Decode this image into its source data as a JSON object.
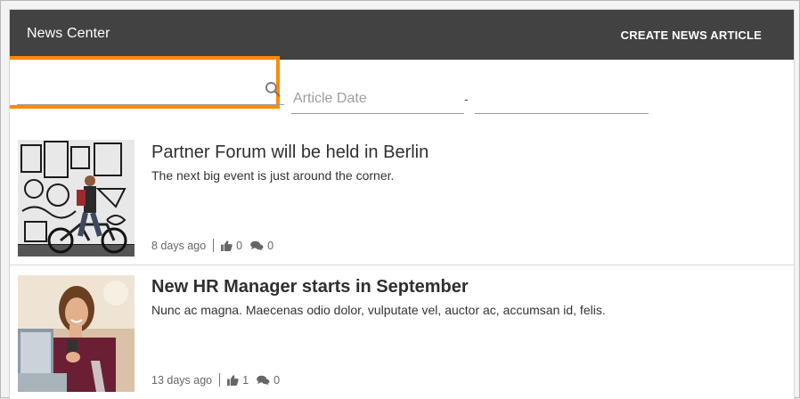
{
  "header": {
    "title": "News Center",
    "create_label": "CREATE NEWS ARTICLE"
  },
  "filters": {
    "search_value": "",
    "date_placeholder": "Article Date",
    "date_range_separator": "-",
    "end_date_value": ""
  },
  "articles": [
    {
      "headline": "Partner Forum will be held in Berlin",
      "description": "The next big event is just around the corner.",
      "age": "8 days ago",
      "likes": "0",
      "comments": "0",
      "image": "graffiti-wall-cyclist"
    },
    {
      "headline": "New HR Manager starts in September",
      "description": "Nunc ac magna. Maecenas odio dolor, vulputate vel, auctor ac, accumsan id, felis.",
      "age": "13 days ago",
      "likes": "1",
      "comments": "0",
      "image": "woman-with-laptop-and-phone"
    }
  ],
  "colors": {
    "topbar": "#424242",
    "highlight": "#ff8a00"
  }
}
